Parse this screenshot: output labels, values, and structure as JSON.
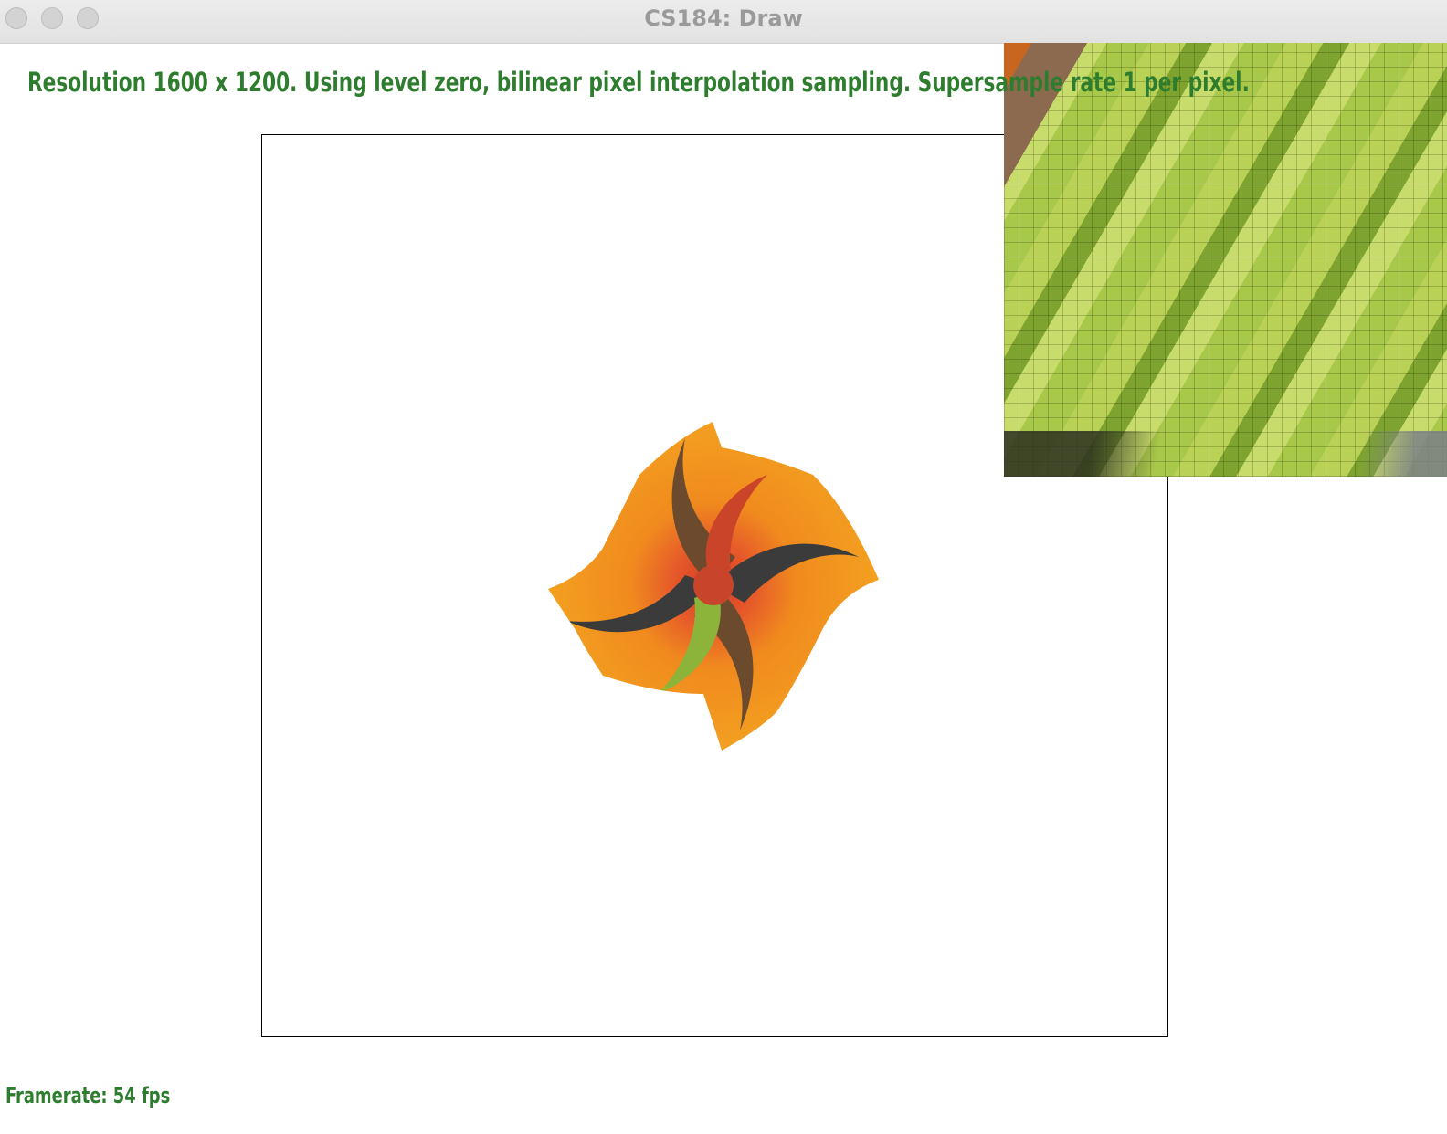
{
  "window": {
    "title": "CS184: Draw"
  },
  "status": {
    "top_text": "Resolution 1600 x 1200. Using level zero, bilinear pixel interpolation sampling. Supersample rate 1 per pixel.",
    "bottom_text": "Framerate: 54 fps"
  },
  "colors": {
    "hud_text": "#2e7d2e",
    "canvas_border": "#000000"
  },
  "icons": {
    "close": "close-icon",
    "minimize": "minimize-icon",
    "zoom": "zoom-icon"
  }
}
